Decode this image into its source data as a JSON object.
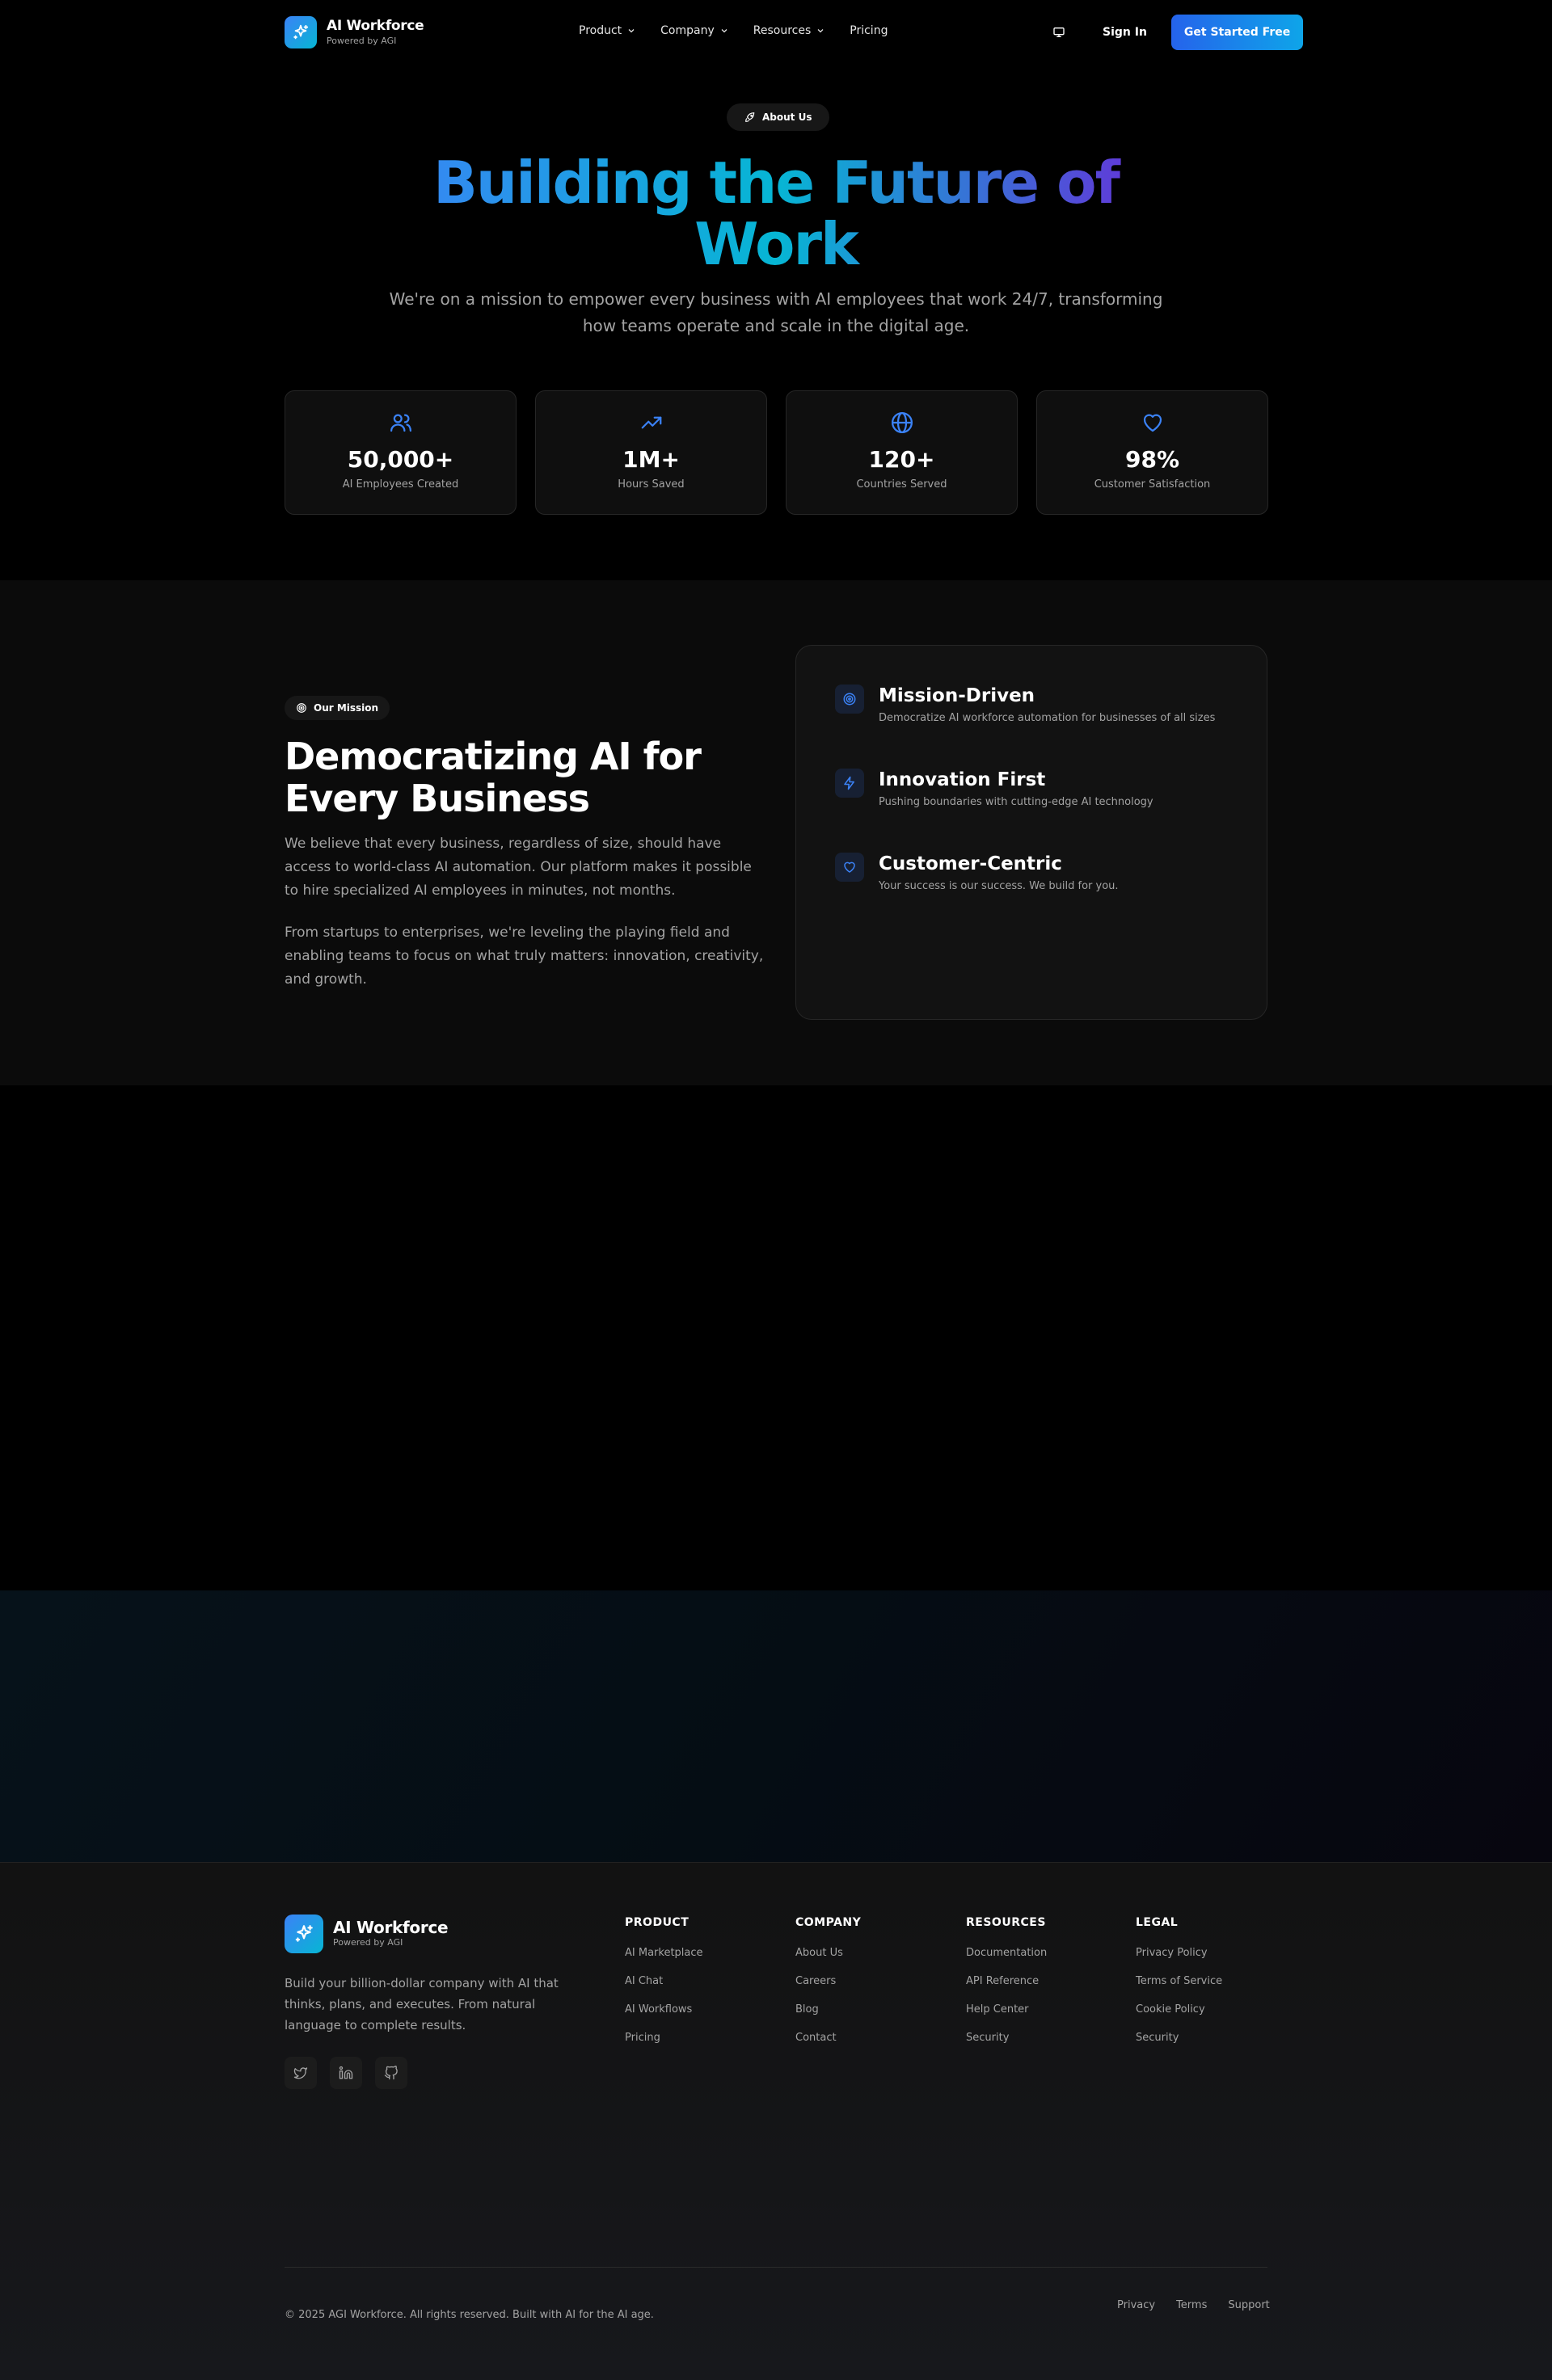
{
  "header": {
    "brand": "AI Workforce",
    "brand_sub": "Powered by AGI",
    "nav": [
      "Product",
      "Company",
      "Resources",
      "Pricing"
    ],
    "sign_in": "Sign In",
    "cta": "Get Started Free"
  },
  "hero": {
    "badge": "About Us",
    "title_line1": "Building the Future of",
    "title_line2": "Work",
    "subtitle": "We're on a mission to empower every business with AI employees that work 24/7, transforming how teams operate and scale in the digital age."
  },
  "stats": [
    {
      "value": "50,000+",
      "label": "AI Employees Created",
      "icon": "users-icon"
    },
    {
      "value": "1M+",
      "label": "Hours Saved",
      "icon": "trending-up-icon"
    },
    {
      "value": "120+",
      "label": "Countries Served",
      "icon": "globe-icon"
    },
    {
      "value": "98%",
      "label": "Customer Satisfaction",
      "icon": "heart-icon"
    }
  ],
  "mission": {
    "badge": "Our Mission",
    "title": "Democratizing AI for Every Business",
    "p1": "We believe that every business, regardless of size, should have access to world-class AI automation. Our platform makes it possible to hire specialized AI employees in minutes, not months.",
    "p2": "From startups to enterprises, we're leveling the playing field and enabling teams to focus on what truly matters: innovation, creativity, and growth.",
    "values": [
      {
        "title": "Mission-Driven",
        "desc": "Democratize AI workforce automation for businesses of all sizes",
        "icon": "target-icon"
      },
      {
        "title": "Innovation First",
        "desc": "Pushing boundaries with cutting-edge AI technology",
        "icon": "zap-icon"
      },
      {
        "title": "Customer-Centric",
        "desc": "Your success is our success. We build for you.",
        "icon": "heart-icon"
      }
    ]
  },
  "footer": {
    "brand": "AI Workforce",
    "brand_sub": "Powered by AGI",
    "description": "Build your billion-dollar company with AI that thinks, plans, and executes. From natural language to complete results.",
    "columns": [
      {
        "title": "PRODUCT",
        "links": [
          "AI Marketplace",
          "AI Chat",
          "AI Workflows",
          "Pricing"
        ]
      },
      {
        "title": "COMPANY",
        "links": [
          "About Us",
          "Careers",
          "Blog",
          "Contact"
        ]
      },
      {
        "title": "RESOURCES",
        "links": [
          "Documentation",
          "API Reference",
          "Help Center",
          "Security"
        ]
      },
      {
        "title": "LEGAL",
        "links": [
          "Privacy Policy",
          "Terms of Service",
          "Cookie Policy",
          "Security"
        ]
      }
    ],
    "copyright": "© 2025 AGI Workforce. All rights reserved. Built with AI for the AI age.",
    "bottom_links": [
      "Privacy",
      "Terms",
      "Support"
    ]
  },
  "colors": {
    "accent": "#3b82f6",
    "accent_cyan": "#06b6d4",
    "background": "#000000",
    "muted_text": "#a3a3a3"
  }
}
